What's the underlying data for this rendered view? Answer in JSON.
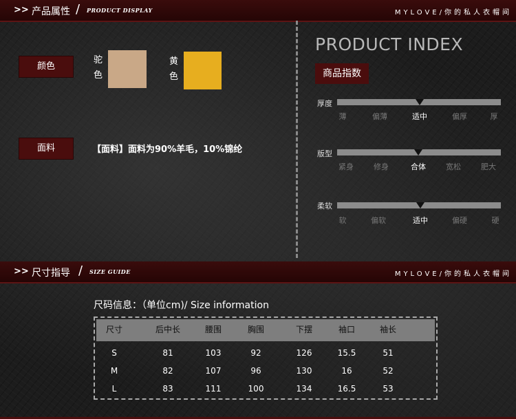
{
  "section1": {
    "arrows": ">>",
    "title": "产品属性",
    "slash": "/",
    "script": "PRODUCT DISPLAY",
    "brand": "MYLOVE/你的私人衣帽间"
  },
  "colors": {
    "label": "颜色",
    "items": [
      {
        "name_line1": "驼",
        "name_line2": "色",
        "hex": "#c9a887"
      },
      {
        "name_line1": "黄",
        "name_line2": "色",
        "hex": "#e7ae1f"
      }
    ]
  },
  "fabric": {
    "label": "面料",
    "text": "【面料】面料为90%羊毛，10%锦纶"
  },
  "product_index": {
    "title": "PRODUCT INDEX",
    "badge": "商品指数",
    "sliders": [
      {
        "label": "厚度",
        "options": [
          "薄",
          "偏薄",
          "适中",
          "偏厚",
          "厚"
        ],
        "selected_index": 2
      },
      {
        "label": "版型",
        "options": [
          "紧身",
          "修身",
          "合体",
          "宽松",
          "肥大"
        ],
        "selected_index": 2
      },
      {
        "label": "柔软",
        "options": [
          "软",
          "偏软",
          "适中",
          "偏硬",
          "硬"
        ],
        "selected_index": 2
      }
    ]
  },
  "section2": {
    "arrows": ">>",
    "title": "尺寸指导",
    "slash": "/",
    "script": "SIZE GUIDE",
    "brand": "MYLOVE/你的私人衣帽间"
  },
  "size_table": {
    "caption": "尺码信息：（单位cm)/ Size information",
    "headers": [
      "尺寸",
      "后中长",
      "腰围",
      "胸围",
      "下摆",
      "袖口",
      "袖长"
    ],
    "rows": [
      [
        "S",
        "81",
        "103",
        "92",
        "126",
        "15.5",
        "51"
      ],
      [
        "M",
        "82",
        "107",
        "96",
        "130",
        "16",
        "52"
      ],
      [
        "L",
        "83",
        "111",
        "100",
        "134",
        "16.5",
        "53"
      ]
    ]
  }
}
